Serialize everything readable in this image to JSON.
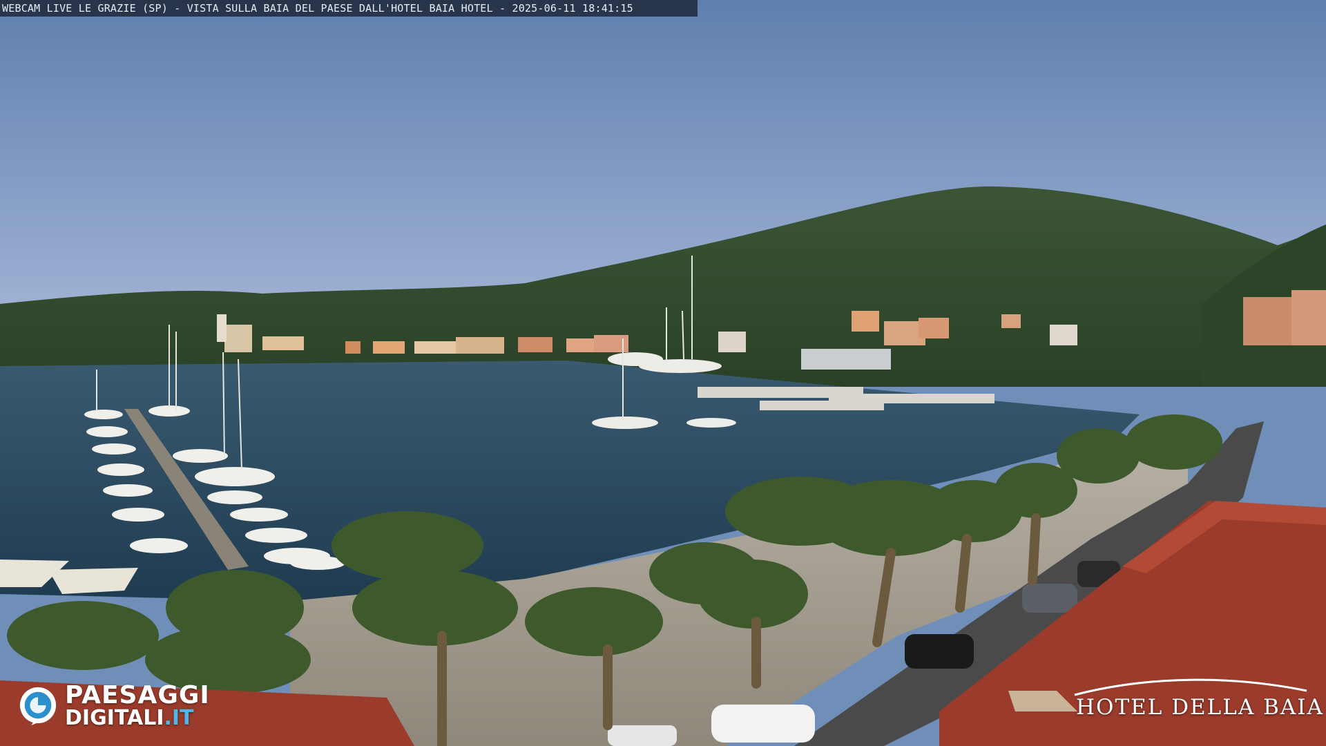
{
  "overlay": {
    "caption": "WEBCAM LIVE LE GRAZIE (SP) - VISTA SULLA BAIA DEL PAESE DALL'HOTEL BAIA HOTEL - 2025-06-11 18:41:15"
  },
  "watermarks": {
    "provider": {
      "line1": "PAESAGGI",
      "line2_main": "DIGITALI",
      "line2_tld": ".IT",
      "accent_color": "#4fb6ea"
    },
    "hotel": {
      "text": "HOTEL DELLA BAIA"
    }
  },
  "scene": {
    "sky_top": "#5f7fae",
    "sky_bottom": "#a7b9d6",
    "hill_color": "#2f4a2c",
    "water_color": "#25455c",
    "roof_color": "#9a3b2b",
    "palm_color": "#3e5a2c"
  }
}
